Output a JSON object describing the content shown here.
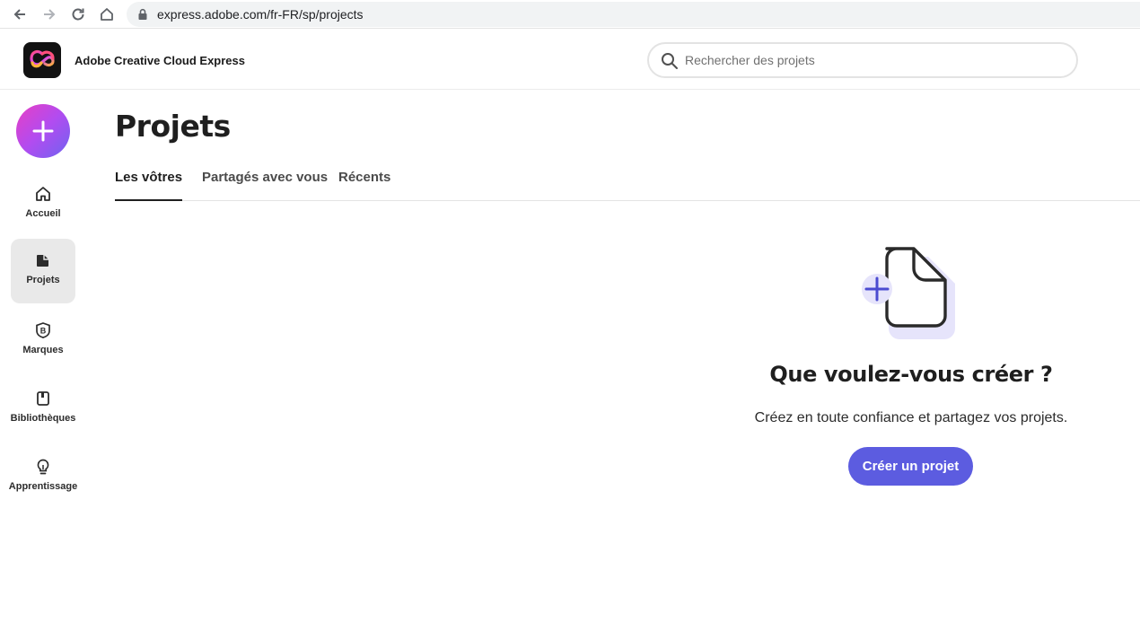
{
  "browser": {
    "url": "express.adobe.com/fr-FR/sp/projects"
  },
  "header": {
    "app_title": "Adobe Creative Cloud Express",
    "search_placeholder": "Rechercher des projets"
  },
  "sidebar": {
    "items": [
      {
        "label": "Accueil",
        "icon": "home-icon"
      },
      {
        "label": "Projets",
        "icon": "projects-icon",
        "active": true
      },
      {
        "label": "Marques",
        "icon": "brand-icon"
      },
      {
        "label": "Bibliothèques",
        "icon": "library-icon"
      },
      {
        "label": "Apprentissage",
        "icon": "lightbulb-icon"
      }
    ]
  },
  "main": {
    "title": "Projets",
    "tabs": [
      {
        "label": "Les vôtres",
        "active": true
      },
      {
        "label": "Partagés avec vous"
      },
      {
        "label": "Récents"
      }
    ],
    "empty_state": {
      "title": "Que voulez-vous créer ?",
      "subtitle": "Créez en toute confiance et partagez vos projets.",
      "button_label": "Créer un projet"
    }
  },
  "colors": {
    "accent": "#5c5ce0",
    "fab_gradient_start": "#e83fc4",
    "fab_gradient_end": "#6f63f0"
  }
}
